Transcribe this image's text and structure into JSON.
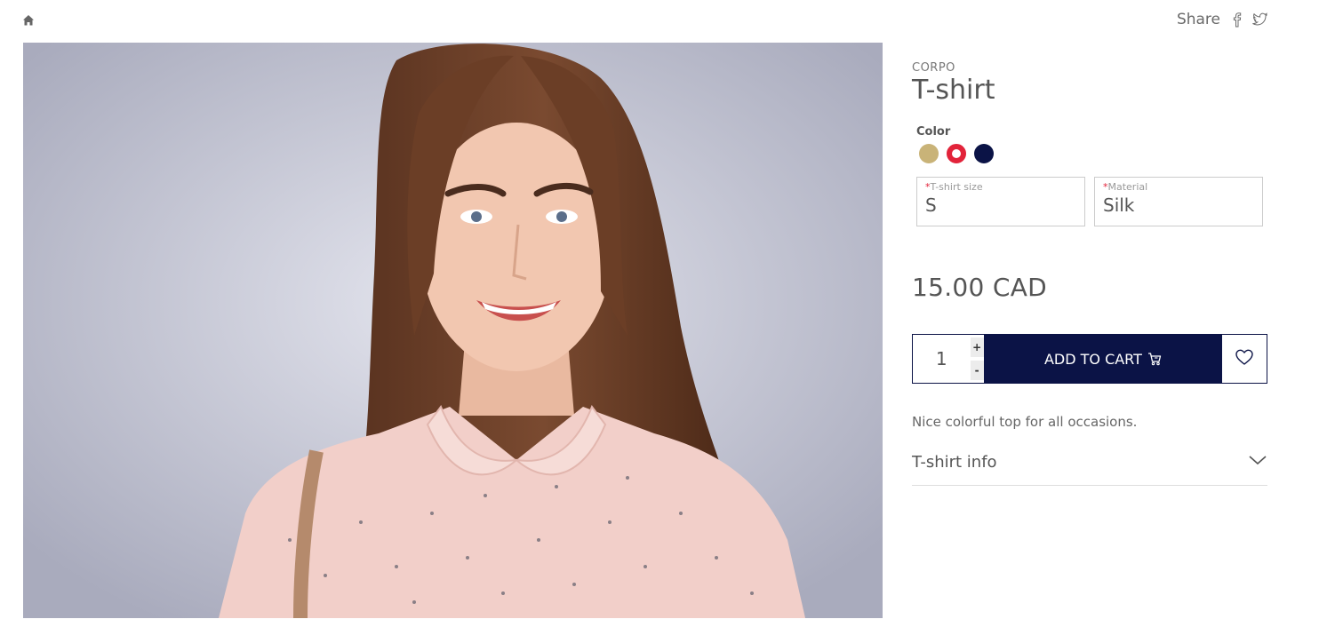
{
  "header": {
    "home_icon": "home-icon",
    "share_label": "Share",
    "social_icons": [
      "facebook-icon",
      "twitter-icon"
    ]
  },
  "product": {
    "brand": "CORPO",
    "title": "T-shirt",
    "color": {
      "label": "Color",
      "swatches": [
        {
          "name": "gold",
          "hex": "#c9b378",
          "selected": false
        },
        {
          "name": "red",
          "hex": "#e2233a",
          "selected": true
        },
        {
          "name": "navy",
          "hex": "#0b1346",
          "selected": false
        }
      ]
    },
    "size_field": {
      "required_mark": "*",
      "label": "T-shirt size",
      "value": "S"
    },
    "material_field": {
      "required_mark": "*",
      "label": "Material",
      "value": "Silk"
    },
    "price": "15.00 CAD",
    "quantity": "1",
    "qty_plus": "+",
    "qty_minus": "-",
    "add_to_cart_label": "ADD TO CART",
    "description": "Nice colorful top for all occasions.",
    "accordion_label": "T-shirt info"
  },
  "colors": {
    "accent": "#0b1346",
    "required": "#e2233a",
    "text": "#555555"
  }
}
